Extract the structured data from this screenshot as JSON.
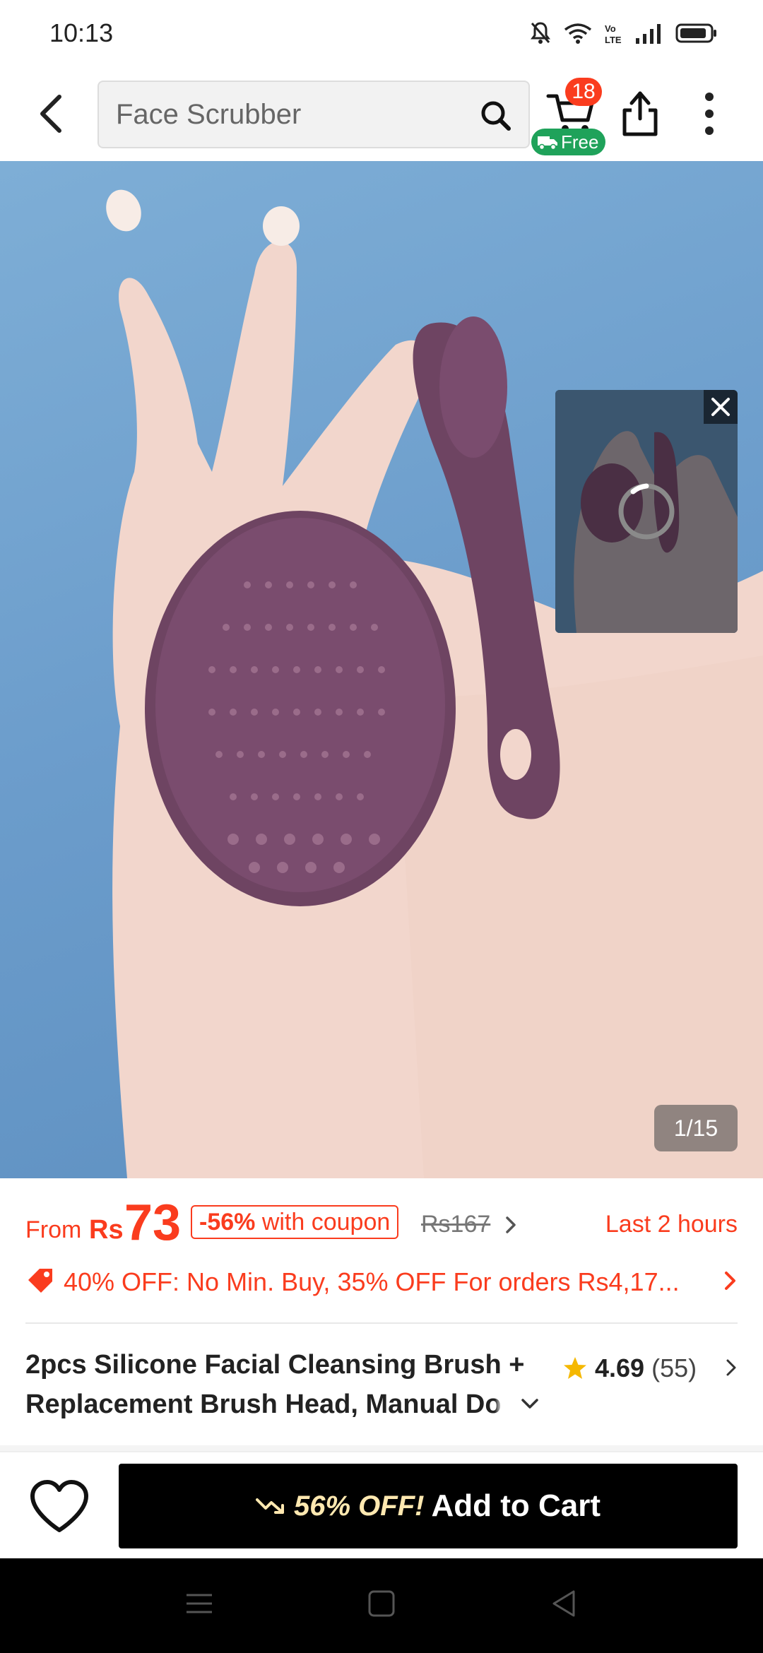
{
  "status_bar": {
    "time": "10:13"
  },
  "header": {
    "search_value": "Face Scrubber",
    "cart_count": "18",
    "free_label": "Free"
  },
  "gallery": {
    "counter": "1/15"
  },
  "price": {
    "from_label": "From",
    "currency": "Rs",
    "value": "73",
    "coupon_discount": "-56%",
    "coupon_suffix": "with coupon",
    "old_price": "Rs167",
    "countdown": "Last 2 hours"
  },
  "promo": {
    "text": "40% OFF: No Min. Buy,  35% OFF For orders Rs4,17..."
  },
  "product": {
    "title_line1": "2pcs Silicone Facial Cleansing Brush +",
    "title_line2_visible": "Replacement Brush Head, Manual D",
    "title_line2_faded": "o",
    "rating_score": "4.69",
    "rating_count": "(55)"
  },
  "bottom_bar": {
    "discount_label": "56% OFF!",
    "add_to_cart_label": "Add to Cart"
  },
  "colors": {
    "accent": "#fa3c1e",
    "free_badge": "#1fa25a",
    "star": "#f5b800",
    "hero_bg": "#6b9ccb",
    "product": "#6e4462"
  },
  "icons": [
    "back-arrow-icon",
    "search-icon",
    "cart-icon",
    "truck-icon",
    "share-icon",
    "more-icon",
    "close-icon",
    "tag-icon",
    "star-icon",
    "heart-icon",
    "trend-down-icon",
    "chevron-right-icon",
    "chevron-down-icon",
    "menu-nav-icon",
    "home-nav-icon",
    "back-nav-icon"
  ]
}
